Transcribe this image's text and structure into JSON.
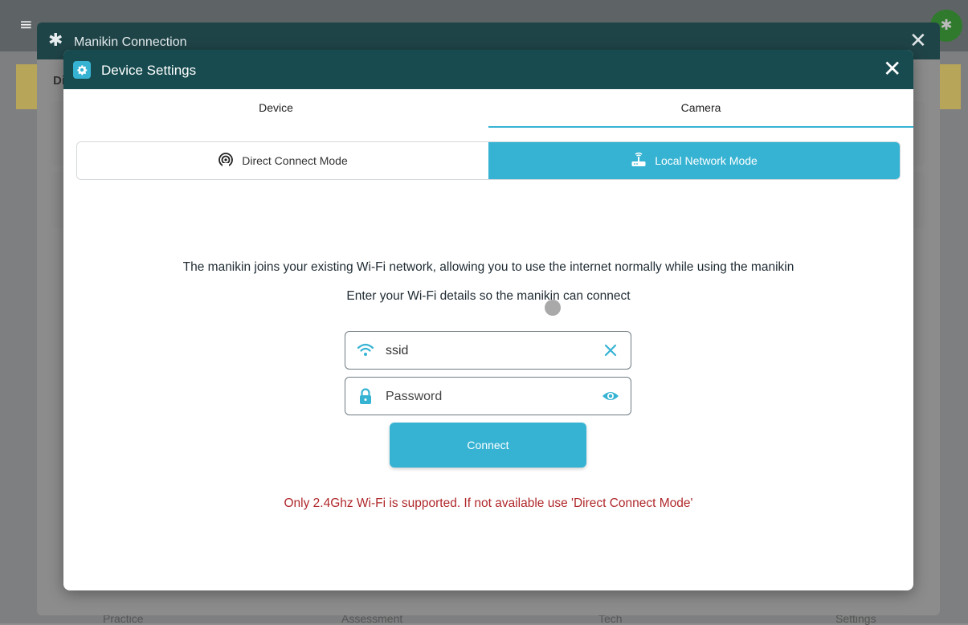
{
  "background": {
    "footer": [
      "Practice",
      "Assessment",
      "Tech",
      "Settings"
    ]
  },
  "outer_window": {
    "title": "Manikin Connection",
    "tab_label": "Di"
  },
  "modal": {
    "title": "Device Settings",
    "tabs": [
      {
        "label": "Device",
        "active": false
      },
      {
        "label": "Camera",
        "active": true
      }
    ],
    "modes": [
      {
        "label": "Direct Connect Mode",
        "icon": "broadcast-icon",
        "active": false
      },
      {
        "label": "Local Network Mode",
        "icon": "router-icon",
        "active": true
      }
    ],
    "description": "The manikin joins your existing Wi-Fi network, allowing you to use the internet normally while using the manikin",
    "instruction": "Enter your Wi-Fi details so the manikin can connect",
    "ssid": {
      "value": "ssid",
      "icon": "wifi-icon",
      "action_icon": "clear-icon"
    },
    "password": {
      "placeholder": "Password",
      "icon": "lock-icon",
      "action_icon": "eye-icon"
    },
    "connect_label": "Connect",
    "warning": "Only 2.4Ghz Wi-Fi is supported. If not available use 'Direct Connect Mode'"
  },
  "colors": {
    "accent": "#36b3d3",
    "header": "#174b4f",
    "warning": "#b0282b"
  }
}
